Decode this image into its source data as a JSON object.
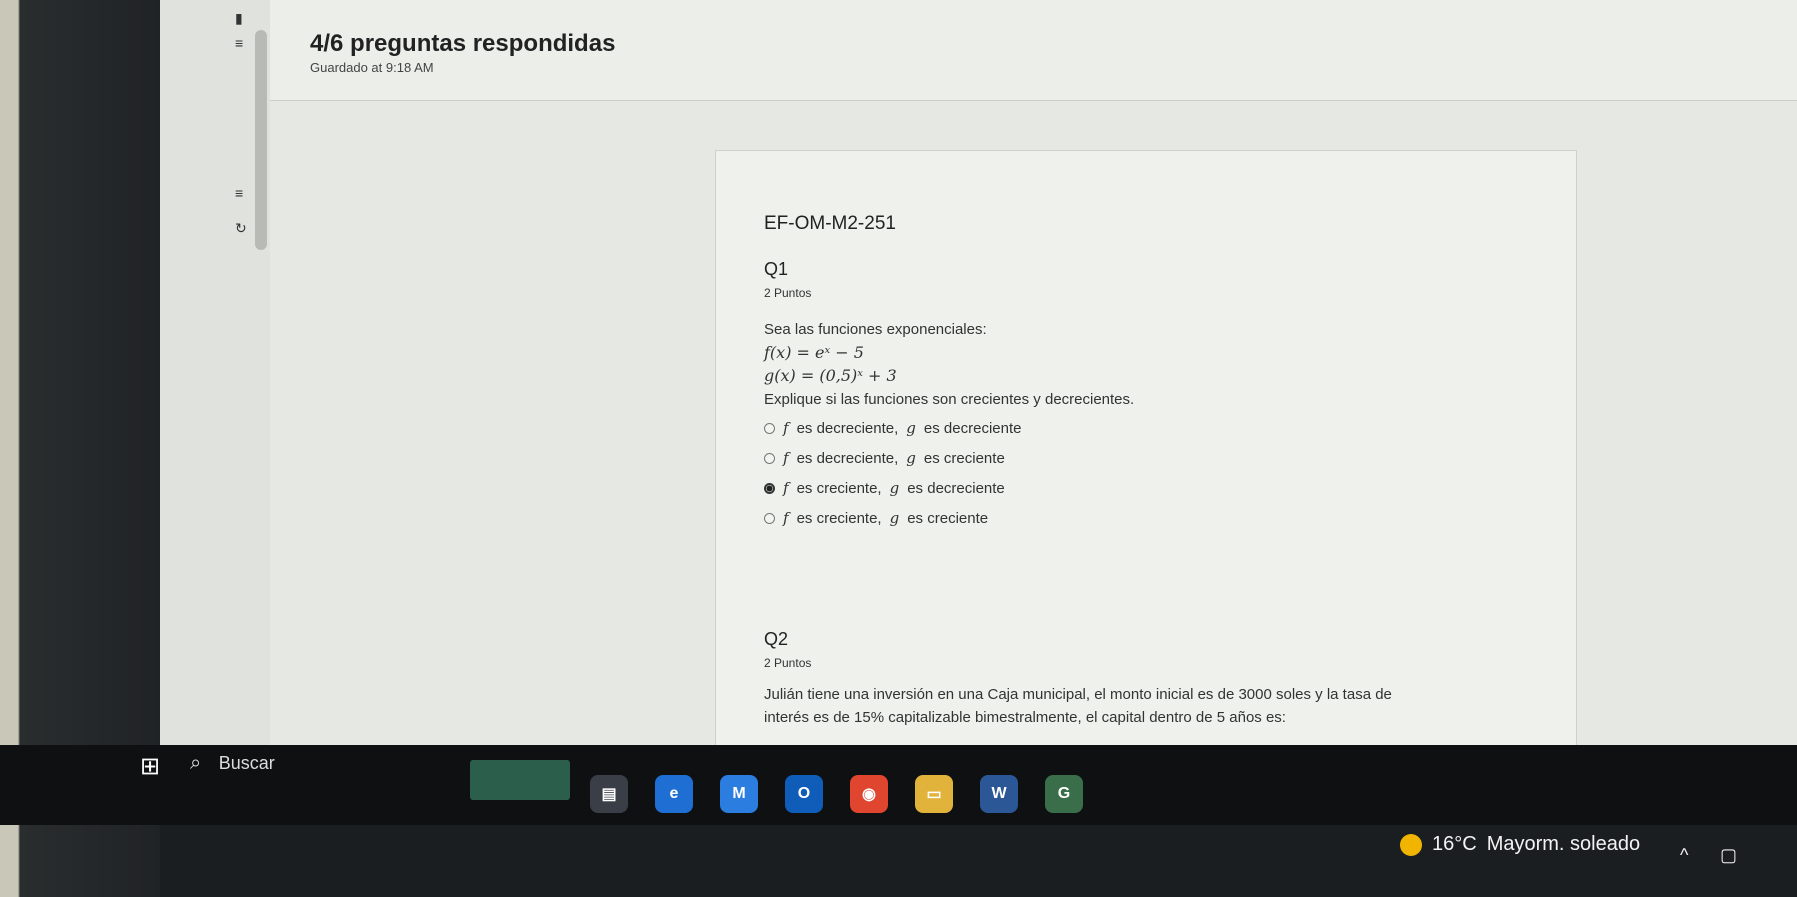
{
  "header": {
    "title": "4/6 preguntas respondidas",
    "saved": "Guardado at 9:18 AM"
  },
  "exam": {
    "code": "EF-OM-M2-251",
    "q1": {
      "label": "Q1",
      "points": "2 Puntos",
      "intro": "Sea las funciones exponenciales:",
      "f": "f(x) = eˣ − 5",
      "g": "g(x) = (0,5)ˣ + 3",
      "prompt": "Explique si las funciones son crecientes y decrecientes.",
      "options": [
        {
          "f": "f",
          "t1": "es decreciente,",
          "g": "g",
          "t2": "es decreciente",
          "selected": false
        },
        {
          "f": "f",
          "t1": "es decreciente,",
          "g": "g",
          "t2": "es creciente",
          "selected": false
        },
        {
          "f": "f",
          "t1": "es creciente,",
          "g": "g",
          "t2": "es decreciente",
          "selected": true
        },
        {
          "f": "f",
          "t1": "es creciente,",
          "g": "g",
          "t2": "es creciente",
          "selected": false
        }
      ]
    },
    "q2": {
      "label": "Q2",
      "points": "2 Puntos",
      "line1": "Julián tiene una inversión en una Caja municipal, el monto inicial es de 3000 soles y la tasa de",
      "line2": "interés es de 15% capitalizable bimestralmente, el capital dentro de 5 años es:"
    }
  },
  "taskbar": {
    "search_placeholder": "Buscar",
    "weather_temp": "16°C",
    "weather_desc": "Mayorm. soleado"
  },
  "colors": {
    "screen_bg": "#e6e8e3",
    "taskbar_bg": "#0e1012"
  }
}
